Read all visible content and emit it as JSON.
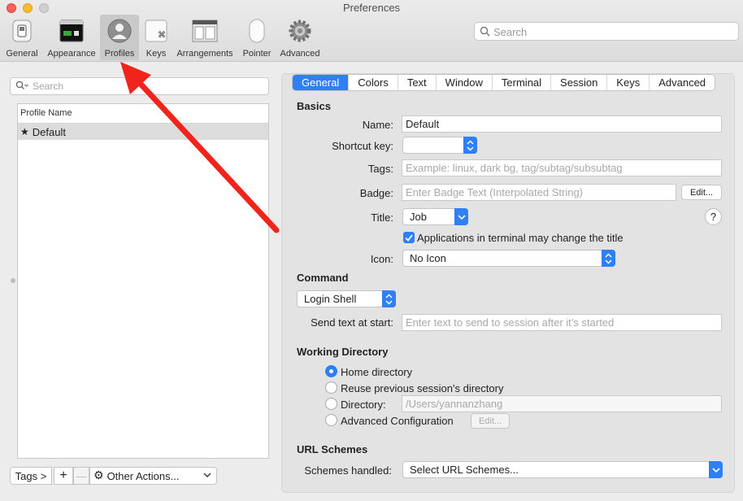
{
  "window": {
    "title": "Preferences"
  },
  "toolbar": {
    "items": [
      {
        "label": "General",
        "icon": "general-switch-icon"
      },
      {
        "label": "Appearance",
        "icon": "terminal-window-icon"
      },
      {
        "label": "Profiles",
        "icon": "user-silhouette-icon",
        "active": true
      },
      {
        "label": "Keys",
        "icon": "command-key-icon"
      },
      {
        "label": "Arrangements",
        "icon": "window-arrangement-icon"
      },
      {
        "label": "Pointer",
        "icon": "mouse-icon"
      },
      {
        "label": "Advanced",
        "icon": "gear-icon"
      }
    ],
    "search_placeholder": "Search"
  },
  "profiles_pane": {
    "search_placeholder": "Search",
    "column_header": "Profile Name",
    "profiles": [
      {
        "name": "Default",
        "is_default": true
      }
    ],
    "tags_button": "Tags >",
    "add_button": "+",
    "remove_button": "—",
    "other_actions": "Other Actions..."
  },
  "tabs": [
    "General",
    "Colors",
    "Text",
    "Window",
    "Terminal",
    "Session",
    "Keys",
    "Advanced"
  ],
  "selected_tab": "General",
  "basics": {
    "title": "Basics",
    "name_label": "Name:",
    "name_value": "Default",
    "shortcut_label": "Shortcut key:",
    "shortcut_value": "",
    "tags_label": "Tags:",
    "tags_placeholder": "Example: linux, dark bg, tag/subtag/subsubtag",
    "badge_label": "Badge:",
    "badge_placeholder": "Enter Badge Text (Interpolated String)",
    "badge_edit": "Edit...",
    "title_label": "Title:",
    "title_value": "Job",
    "help": "?",
    "apps_change_title": "Applications in terminal may change the title",
    "apps_change_title_checked": true,
    "icon_label": "Icon:",
    "icon_value": "No Icon"
  },
  "command": {
    "title": "Command",
    "shell_value": "Login Shell",
    "send_text_label": "Send text at start:",
    "send_text_placeholder": "Enter text to send to session after it’s started"
  },
  "working_directory": {
    "title": "Working Directory",
    "options": [
      {
        "label": "Home directory",
        "selected": true
      },
      {
        "label": "Reuse previous session's directory",
        "selected": false
      },
      {
        "label": "Directory:",
        "selected": false
      },
      {
        "label": "Advanced Configuration",
        "selected": false
      }
    ],
    "directory_placeholder": "/Users/yannanzhang",
    "advanced_edit": "Edit..."
  },
  "url_schemes": {
    "title": "URL Schemes",
    "handled_label": "Schemes handled:",
    "handled_value": "Select URL Schemes..."
  },
  "colors": {
    "accent": "#2f7ff6",
    "annotation_arrow": "#f0241b"
  }
}
